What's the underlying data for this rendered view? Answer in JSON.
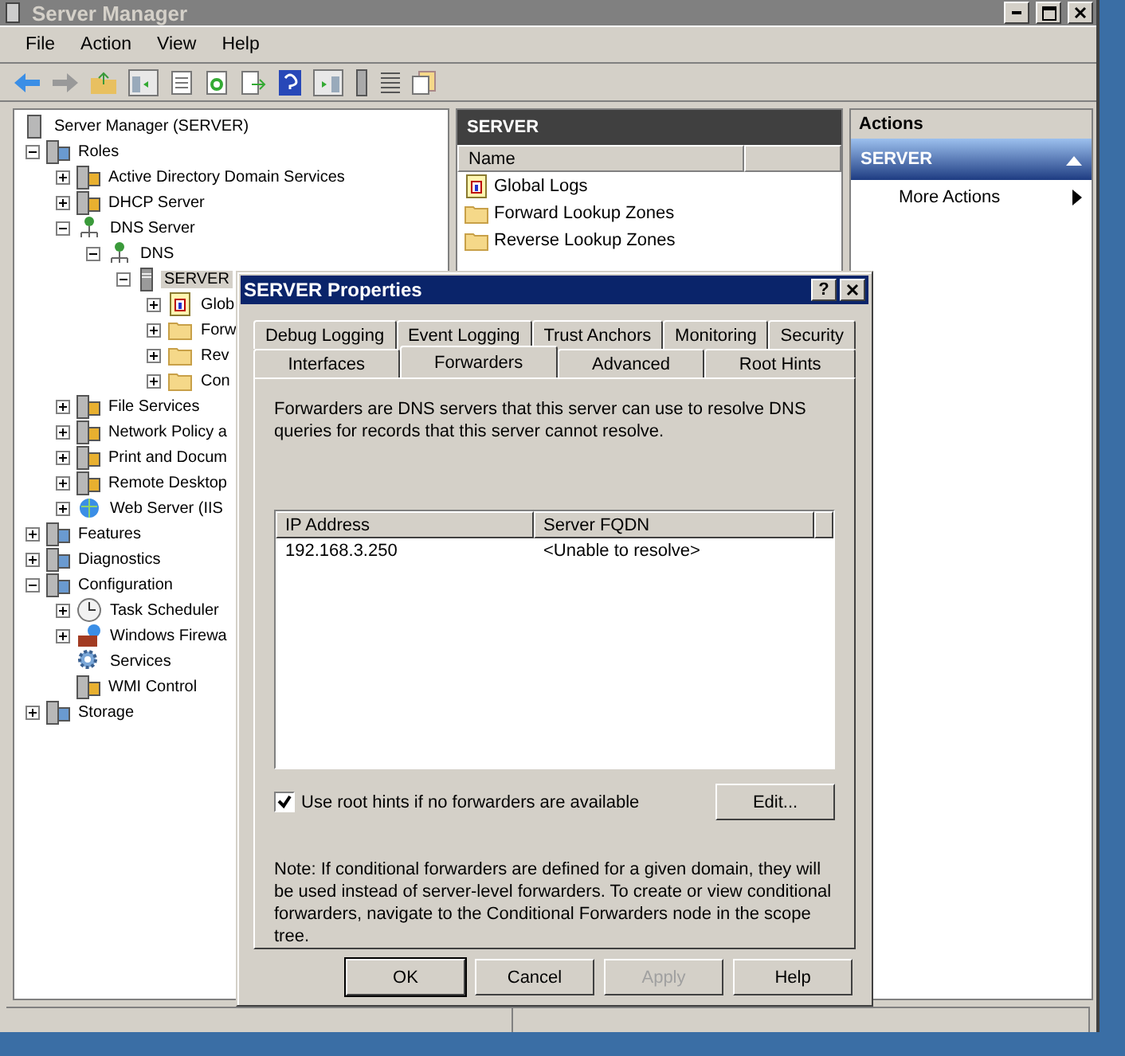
{
  "window": {
    "title": "Server Manager"
  },
  "menu": [
    "File",
    "Action",
    "View",
    "Help"
  ],
  "tree": [
    {
      "label": "Server Manager (SERVER)",
      "kind": "server",
      "selected": false,
      "children": [
        {
          "label": "Roles",
          "kind": "roles",
          "expanded": true,
          "selected": false,
          "children": [
            {
              "label": "Active Directory Domain Services",
              "kind": "role",
              "expanded": false,
              "selected": false
            },
            {
              "label": "DHCP Server",
              "kind": "role",
              "expanded": false,
              "selected": false
            },
            {
              "label": "DNS Server",
              "kind": "network",
              "expanded": true,
              "selected": false,
              "children": [
                {
                  "label": "DNS",
                  "kind": "network",
                  "expanded": true,
                  "selected": false,
                  "children": [
                    {
                      "label": "SERVER",
                      "kind": "machine",
                      "expanded": true,
                      "selected": true,
                      "children": [
                        {
                          "label": "Glob",
                          "kind": "log",
                          "expanded": false,
                          "selected": false
                        },
                        {
                          "label": "Forw",
                          "kind": "folder",
                          "expanded": false,
                          "selected": false
                        },
                        {
                          "label": "Rev",
                          "kind": "folder",
                          "expanded": false,
                          "selected": false
                        },
                        {
                          "label": "Con",
                          "kind": "folder",
                          "expanded": false,
                          "selected": false
                        }
                      ]
                    }
                  ]
                }
              ]
            },
            {
              "label": "File Services",
              "kind": "role",
              "expanded": false,
              "selected": false
            },
            {
              "label": "Network Policy a",
              "kind": "role",
              "expanded": false,
              "selected": false
            },
            {
              "label": "Print and Docum",
              "kind": "role",
              "expanded": false,
              "selected": false
            },
            {
              "label": "Remote Desktop",
              "kind": "role",
              "expanded": false,
              "selected": false
            },
            {
              "label": "Web Server (IIS",
              "kind": "web",
              "expanded": false,
              "selected": false
            }
          ]
        },
        {
          "label": "Features",
          "kind": "roles",
          "expanded": false,
          "selected": false
        },
        {
          "label": "Diagnostics",
          "kind": "roles",
          "expanded": false,
          "selected": false
        },
        {
          "label": "Configuration",
          "kind": "roles",
          "expanded": true,
          "selected": false,
          "children": [
            {
              "label": "Task Scheduler",
              "kind": "clock",
              "expanded": false,
              "selected": false
            },
            {
              "label": "Windows Firewa",
              "kind": "firewall",
              "expanded": false,
              "selected": false
            },
            {
              "label": "Services",
              "kind": "gear",
              "selected": false
            },
            {
              "label": "WMI Control",
              "kind": "role",
              "selected": false
            }
          ]
        },
        {
          "label": "Storage",
          "kind": "roles",
          "expanded": false,
          "selected": false
        }
      ]
    }
  ],
  "center": {
    "title": "SERVER",
    "columns": [
      "Name"
    ],
    "items": [
      {
        "label": "Global Logs",
        "kind": "log"
      },
      {
        "label": "Forward Lookup Zones",
        "kind": "folder"
      },
      {
        "label": "Reverse Lookup Zones",
        "kind": "folder"
      }
    ]
  },
  "actions": {
    "title": "Actions",
    "section": "SERVER",
    "expanded": true,
    "items": [
      "More Actions"
    ]
  },
  "dialog": {
    "title": "SERVER Properties",
    "help": "?",
    "tab_rows": [
      [
        {
          "label": "Debug Logging",
          "selected": false
        },
        {
          "label": "Event Logging",
          "selected": false
        },
        {
          "label": "Trust Anchors",
          "selected": false
        },
        {
          "label": "Monitoring",
          "selected": false
        },
        {
          "label": "Security",
          "selected": false
        }
      ],
      [
        {
          "label": "Interfaces",
          "selected": false
        },
        {
          "label": "Forwarders",
          "selected": true
        },
        {
          "label": "Advanced",
          "selected": false
        },
        {
          "label": "Root Hints",
          "selected": false
        }
      ]
    ],
    "intro": "Forwarders are DNS servers that this server can use to resolve DNS queries for records that this server cannot resolve.",
    "table": {
      "columns": [
        "IP Address",
        "Server FQDN"
      ],
      "rows": [
        [
          "192.168.3.250",
          "<Unable to resolve>"
        ]
      ]
    },
    "checkbox": {
      "label": "Use root hints if no forwarders are available",
      "checked": true
    },
    "edit_button": "Edit...",
    "note": "Note: If conditional forwarders are defined for a given domain, they will be used instead of server-level forwarders.  To create or view conditional forwarders, navigate to the Conditional Forwarders node in the scope tree.",
    "buttons": [
      {
        "label": "OK",
        "default": true,
        "disabled": false
      },
      {
        "label": "Cancel",
        "default": false,
        "disabled": false
      },
      {
        "label": "Apply",
        "default": false,
        "disabled": true
      },
      {
        "label": "Help",
        "default": false,
        "disabled": false
      }
    ]
  }
}
